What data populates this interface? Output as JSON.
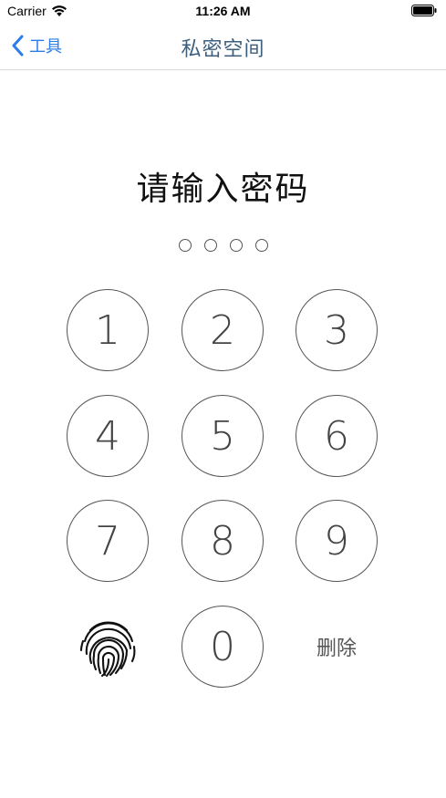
{
  "status_bar": {
    "carrier": "Carrier",
    "time": "11:26 AM"
  },
  "nav": {
    "back_label": "工具",
    "title": "私密空间"
  },
  "lock": {
    "prompt": "请输入密码",
    "passcode_length": 4,
    "entered_count": 0
  },
  "keypad": {
    "keys": [
      "1",
      "2",
      "3",
      "4",
      "5",
      "6",
      "7",
      "8",
      "9",
      "0"
    ],
    "delete_label": "删除",
    "fingerprint_icon": "fingerprint-icon"
  },
  "colors": {
    "accent": "#2b7de9",
    "title": "#3d5f7f",
    "key_stroke": "#555555"
  }
}
